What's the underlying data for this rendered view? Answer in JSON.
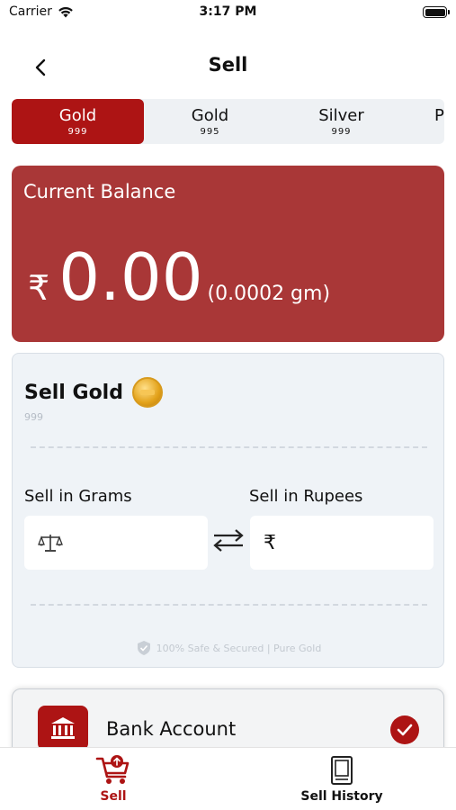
{
  "status": {
    "carrier": "Carrier",
    "time": "3:17 PM"
  },
  "header": {
    "title": "Sell"
  },
  "tabs": [
    {
      "name": "Gold",
      "purity": "999",
      "active": true
    },
    {
      "name": "Gold",
      "purity": "995",
      "active": false
    },
    {
      "name": "Silver",
      "purity": "999",
      "active": false
    },
    {
      "name": "P",
      "purity": "",
      "active": false
    }
  ],
  "balance": {
    "title": "Current Balance",
    "currency": "₹",
    "amount": "0.00",
    "grams": "(0.0002 gm)"
  },
  "sell": {
    "title": "Sell Gold",
    "purity": "999",
    "grams_label": "Sell in Grams",
    "rupees_label": "Sell in Rupees",
    "grams_value": "",
    "rupees_prefix": "₹",
    "rupees_value": "",
    "secure_text": "100% Safe & Secured | Pure Gold"
  },
  "bank": {
    "label": "Bank Account",
    "selected": true
  },
  "bottom_nav": [
    {
      "label": "Sell",
      "icon": "cart-icon",
      "active": true
    },
    {
      "label": "Sell History",
      "icon": "book-icon",
      "active": false
    }
  ],
  "colors": {
    "accent": "#ad1414",
    "balance_card": "#a93737",
    "panel": "#eff3f7"
  }
}
